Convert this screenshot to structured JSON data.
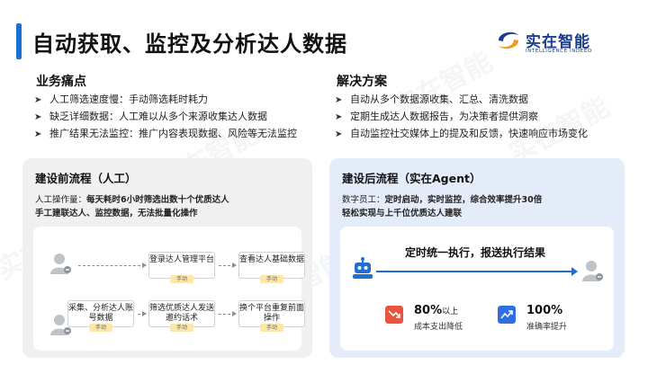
{
  "header": {
    "title": "自动获取、监控及分析达人数据",
    "logo_name": "实在智能",
    "logo_sub": "INTELLIGENCE INDEED",
    "watermark": "实在智能"
  },
  "pain_points": {
    "title": "业务痛点",
    "items": [
      "人工筛选速度慢：手动筛选耗时耗力",
      "缺乏详细数据：人工难以从多个来源收集达人数据",
      "推广结果无法监控：推广内容表现数据、风险等无法监控"
    ]
  },
  "solutions": {
    "title": "解决方案",
    "items": [
      "自动从多个数据源收集、汇总、清洗数据",
      "定期生成达人数据报告，为决策者提供洞察",
      "自动监控社交媒体上的提及和反馈，快速响应市场变化"
    ]
  },
  "before": {
    "title": "建设前流程（人工）",
    "line1_label": "人工操作量：",
    "line1_value": "每天耗时6小时筛选出数十个优质达人",
    "line2": "手工建联达人、监控数据，无法批量化操作",
    "steps": [
      "登录达人管理平台",
      "查看达人基础数据",
      "采集、分析达人账号数据",
      "筛选优质达人发送邀约话术",
      "换个平台重复前面操作"
    ],
    "tag": "手动"
  },
  "after": {
    "title": "建设后流程（实在Agent）",
    "line1_label": "数字员工：",
    "line1_value": "定时启动，实时监控，综合效率提升30倍",
    "line2": "轻松实现与上千位优质达人建联",
    "flow_text": "定时统一执行，报送执行结果",
    "stats": [
      {
        "value": "80%",
        "suffix": "以上",
        "label": "成本支出降低"
      },
      {
        "value": "100%",
        "suffix": "",
        "label": "准确率提升"
      }
    ]
  },
  "colors": {
    "accent": "#1f6fd1",
    "logo": "#1a3d8f",
    "left_panel": "#f0f0f0",
    "right_panel": "#e4ecfa",
    "tag": "#fde7a8",
    "stat_red": "#e8543c",
    "stat_blue": "#2f6fe0"
  },
  "icons": {
    "logo": "logo-swirl-icon",
    "person": "person-icon",
    "robot": "robot-icon",
    "cost": "trend-down-icon",
    "accuracy": "trend-up-icon"
  }
}
